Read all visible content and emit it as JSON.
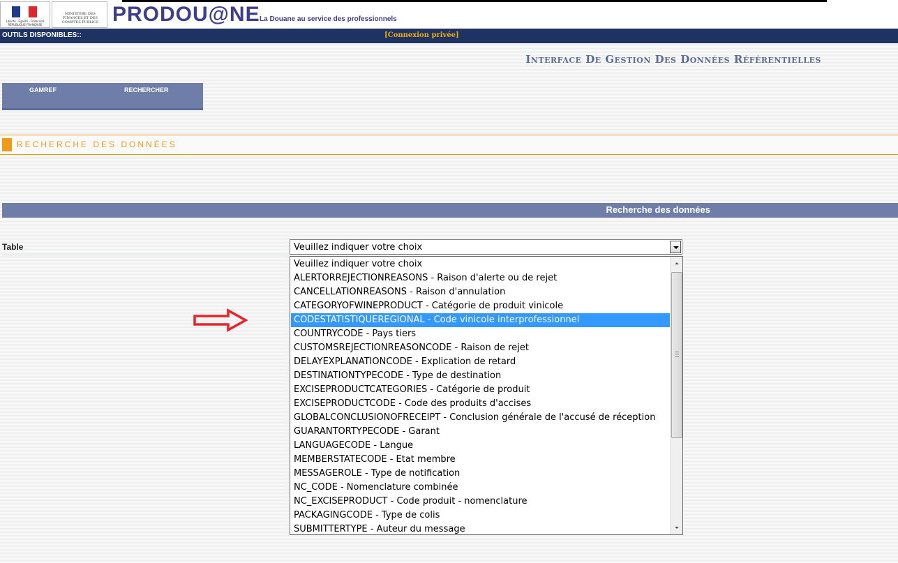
{
  "header": {
    "republic_logo_text": "Liberté · Égalité · Fraternité RÉPUBLIQUE FRANÇAISE",
    "ministry_logo_text": "MINISTÈRE DES FINANCES ET DES COMPTES PUBLICS",
    "brand": "PRODOU@NE",
    "slogan": "La Douane au service des professionnels"
  },
  "topbar": {
    "tools_label": "OUTILS DISPONIBLES::",
    "connexion_label": "[Connexion privée]"
  },
  "page_title": "Interface De Gestion Des Données Référentielles",
  "tabs": [
    {
      "label": "GAMREF"
    },
    {
      "label": "RECHERCHER"
    }
  ],
  "section_title": "RECHERCHE DES DONNÉES",
  "band_title": "Recherche des données",
  "form": {
    "table_label": "Table",
    "select_value": "Veuillez indiquer votre choix"
  },
  "dropdown": {
    "options": [
      "Veuillez indiquer votre choix",
      "ALERTORREJECTIONREASONS - Raison d'alerte ou de rejet",
      "CANCELLATIONREASONS - Raison d'annulation",
      "CATEGORYOFWINEPRODUCT - Catégorie de produit vinicole",
      "CODESTATISTIQUEREGIONAL - Code vinicole interprofessionnel",
      "COUNTRYCODE - Pays tiers",
      "CUSTOMSREJECTIONREASONCODE - Raison de rejet",
      "DELAYEXPLANATIONCODE - Explication de retard",
      "DESTINATIONTYPECODE - Type de destination",
      "EXCISEPRODUCTCATEGORIES - Catégorie de produit",
      "EXCISEPRODUCTCODE - Code des produits d'accises",
      "GLOBALCONCLUSIONOFRECEIPT - Conclusion générale de l'accusé de réception",
      "GUARANTORTYPECODE - Garant",
      "LANGUAGECODE - Langue",
      "MEMBERSTATECODE - Etat membre",
      "MESSAGEROLE - Type de notification",
      "NC_CODE - Nomenclature combinée",
      "NC_EXCISEPRODUCT - Code produit - nomenclature",
      "PACKAGINGCODE - Type de colis",
      "SUBMITTERTYPE - Auteur du message"
    ],
    "selected_index": 4
  },
  "colors": {
    "navy": "#1e3264",
    "accent_orange": "#f29a14",
    "band_blue": "#6f7ea8",
    "highlight": "#3399ff",
    "annotation_red": "#e8252c"
  },
  "icons": [
    "republique-francaise-logo",
    "ministry-logo",
    "dropdown-arrow-icon",
    "scroll-up-icon",
    "scroll-down-icon",
    "red-arrow-icon"
  ]
}
